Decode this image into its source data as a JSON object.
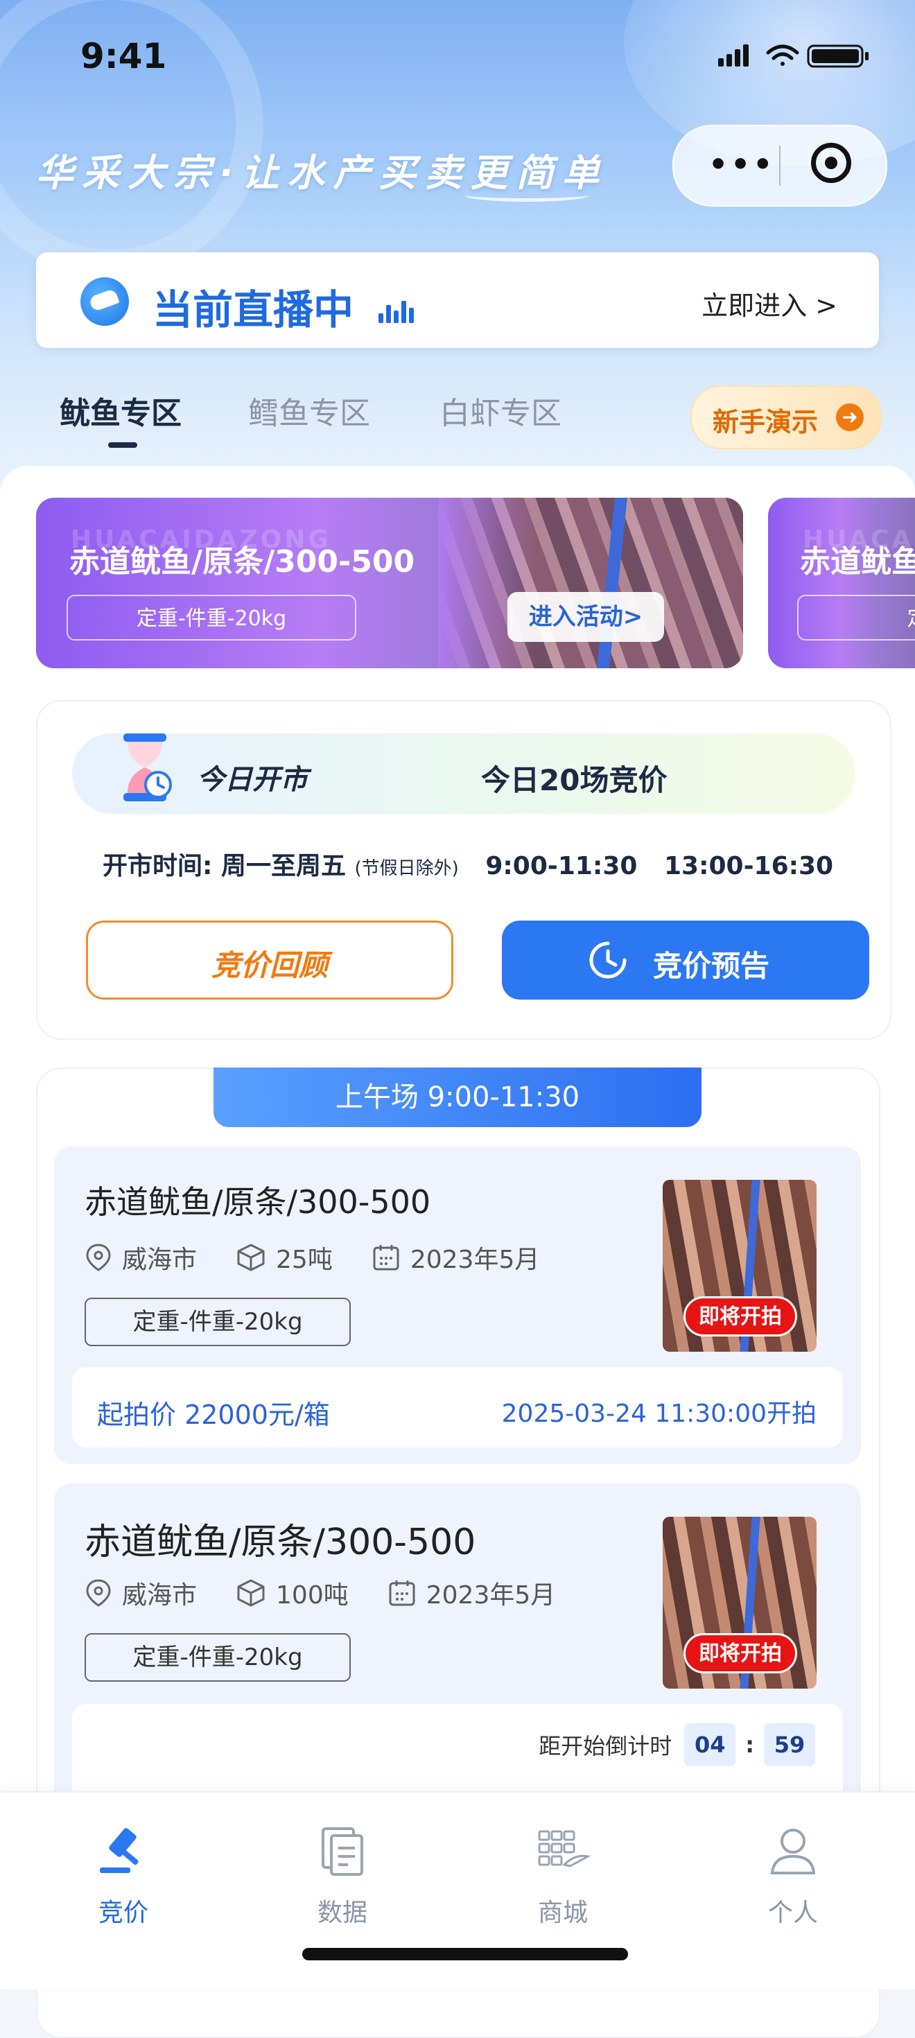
{
  "status": {
    "time": "9:41"
  },
  "header": {
    "slogan": "华采大宗·让水产买卖更简单"
  },
  "live": {
    "title": "当前直播中",
    "enter": "立即进入 >"
  },
  "tabs": [
    {
      "label": "鱿鱼专区",
      "active": true
    },
    {
      "label": "鳕鱼专区",
      "active": false
    },
    {
      "label": "白虾专区",
      "active": false
    }
  ],
  "demo_button": {
    "label": "新手演示"
  },
  "banners": [
    {
      "watermark": "HUACAIDAZONG",
      "title": "赤道鱿鱼/原条/300-500",
      "tag": "定重-件重-20kg",
      "enter": "进入活动>"
    },
    {
      "watermark": "HUACAI",
      "title": "赤道鱿鱼",
      "tag": "定重-件"
    }
  ],
  "market": {
    "today_open": "今日开市",
    "today_count": "今日20场竞价",
    "hours_label": "开市时间:",
    "days": "周一至周五",
    "holiday_note": "(节假日除外)",
    "morning": "9:00-11:30",
    "afternoon": "13:00-16:30",
    "review_button": "竞价回顾",
    "preview_button": "竞价预告"
  },
  "session": {
    "title": "上午场 9:00-11:30"
  },
  "lots": [
    {
      "title": "赤道鱿鱼/原条/300-500",
      "city": "威海市",
      "weight": "25吨",
      "date": "2023年5月",
      "tag": "定重-件重-20kg",
      "badge": "即将开拍",
      "price": "起拍价  22000元/箱",
      "start": "2025-03-24 11:30:00开拍"
    },
    {
      "title": "赤道鱿鱼/原条/300-500",
      "city": "威海市",
      "weight": "100吨",
      "date": "2023年5月",
      "tag": "定重-件重-20kg",
      "badge": "即将开拍",
      "countdown_label": "距开始倒计时",
      "countdown_min": "04",
      "countdown_sep": ":",
      "countdown_sec": "59"
    }
  ],
  "tabbar": [
    {
      "label": "竞价",
      "icon": "gavel-icon",
      "active": true
    },
    {
      "label": "数据",
      "icon": "document-icon",
      "active": false
    },
    {
      "label": "商城",
      "icon": "grid-shop-icon",
      "active": false
    },
    {
      "label": "个人",
      "icon": "user-icon",
      "active": false
    }
  ],
  "colors": {
    "primary": "#2b78f2",
    "orange": "#f07a10",
    "badge_red": "#e61414"
  }
}
